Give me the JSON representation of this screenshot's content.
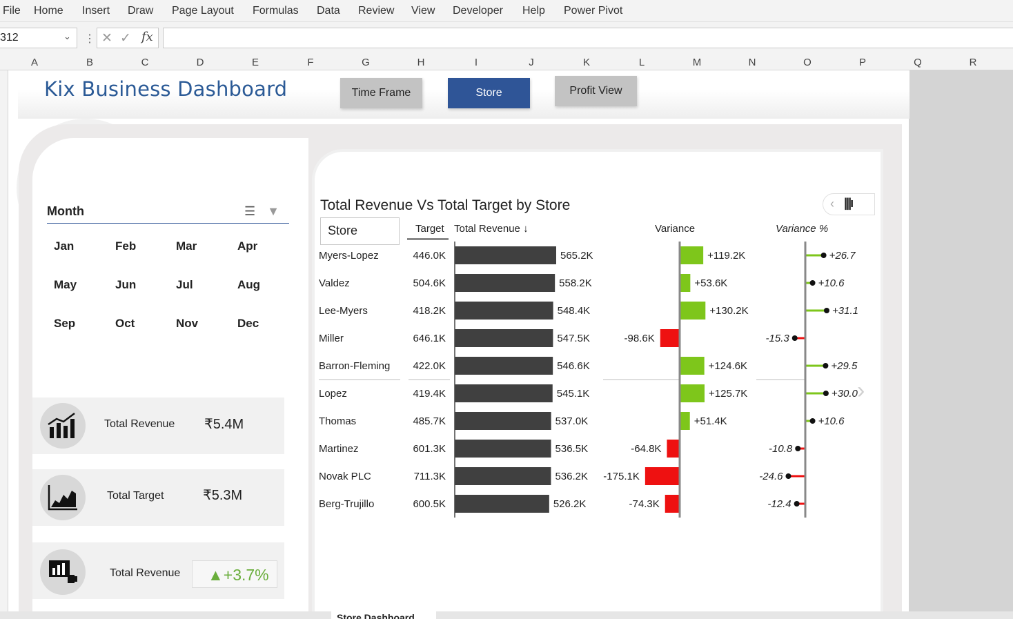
{
  "ribbon": {
    "menu": [
      "File",
      "Home",
      "Insert",
      "Draw",
      "Page Layout",
      "Formulas",
      "Data",
      "Review",
      "View",
      "Developer",
      "Help",
      "Power Pivot"
    ]
  },
  "formula_bar": {
    "name_box": "312",
    "fx_label": "fx",
    "formula": ""
  },
  "columns": [
    "A",
    "B",
    "C",
    "D",
    "E",
    "F",
    "G",
    "H",
    "I",
    "J",
    "K",
    "L",
    "M",
    "N",
    "O",
    "P",
    "Q",
    "R"
  ],
  "dashboard": {
    "title": "Kix Business Dashboard",
    "tabs": {
      "time_frame": "Time Frame",
      "store": "Store",
      "profit_view": "Profit View"
    }
  },
  "slicer": {
    "title": "Month",
    "months": [
      "Jan",
      "Feb",
      "Mar",
      "Apr",
      "May",
      "Jun",
      "Jul",
      "Aug",
      "Sep",
      "Oct",
      "Nov",
      "Dec"
    ]
  },
  "kpis": [
    {
      "label": "Total Revenue",
      "value": "₹5.4M",
      "icon": "revenue-chart-icon"
    },
    {
      "label": "Total Target",
      "value": "₹5.3M",
      "icon": "area-chart-icon"
    },
    {
      "label": "Total Revenue",
      "value": "▲+3.7%",
      "icon": "growth-presentation-icon"
    }
  ],
  "chart_data": {
    "type": "table",
    "title": "Total Revenue Vs Total Target by Store",
    "headers": {
      "store": "Store",
      "target": "Target",
      "revenue": "Total Revenue ↓",
      "variance": "Variance",
      "variance_pct": "Variance %"
    },
    "rows": [
      {
        "store": "Myers-Lopez",
        "target": "446.0K",
        "revenue": "565.2K",
        "revenue_value": 565.2,
        "variance": "+119.2K",
        "variance_value": 119.2,
        "pct": "+26.7",
        "pct_value": 26.7
      },
      {
        "store": "Valdez",
        "target": "504.6K",
        "revenue": "558.2K",
        "revenue_value": 558.2,
        "variance": "+53.6K",
        "variance_value": 53.6,
        "pct": "+10.6",
        "pct_value": 10.6
      },
      {
        "store": "Lee-Myers",
        "target": "418.2K",
        "revenue": "548.4K",
        "revenue_value": 548.4,
        "variance": "+130.2K",
        "variance_value": 130.2,
        "pct": "+31.1",
        "pct_value": 31.1
      },
      {
        "store": "Miller",
        "target": "646.1K",
        "revenue": "547.5K",
        "revenue_value": 547.5,
        "variance": "-98.6K",
        "variance_value": -98.6,
        "pct": "-15.3",
        "pct_value": -15.3
      },
      {
        "store": "Barron-Fleming",
        "target": "422.0K",
        "revenue": "546.6K",
        "revenue_value": 546.6,
        "variance": "+124.6K",
        "variance_value": 124.6,
        "pct": "+29.5",
        "pct_value": 29.5
      },
      {
        "store": "Lopez",
        "target": "419.4K",
        "revenue": "545.1K",
        "revenue_value": 545.1,
        "variance": "+125.7K",
        "variance_value": 125.7,
        "pct": "+30.0",
        "pct_value": 30.0
      },
      {
        "store": "Thomas",
        "target": "485.7K",
        "revenue": "537.0K",
        "revenue_value": 537.0,
        "variance": "+51.4K",
        "variance_value": 51.4,
        "pct": "+10.6",
        "pct_value": 10.6
      },
      {
        "store": "Martinez",
        "target": "601.3K",
        "revenue": "536.5K",
        "revenue_value": 536.5,
        "variance": "-64.8K",
        "variance_value": -64.8,
        "pct": "-10.8",
        "pct_value": -10.8
      },
      {
        "store": "Novak PLC",
        "target": "711.3K",
        "revenue": "536.2K",
        "revenue_value": 536.2,
        "variance": "-175.1K",
        "variance_value": -175.1,
        "pct": "-24.6",
        "pct_value": -24.6
      },
      {
        "store": "Berg-Trujillo",
        "target": "600.5K",
        "revenue": "526.2K",
        "revenue_value": 526.2,
        "variance": "-74.3K",
        "variance_value": -74.3,
        "pct": "-12.4",
        "pct_value": -12.4
      }
    ],
    "colors": {
      "revenue_bar": "#404040",
      "positive": "#7ec61b",
      "negative": "#ee1111",
      "axis": "#888888"
    }
  },
  "sheet_tab": "Store Dashboard"
}
